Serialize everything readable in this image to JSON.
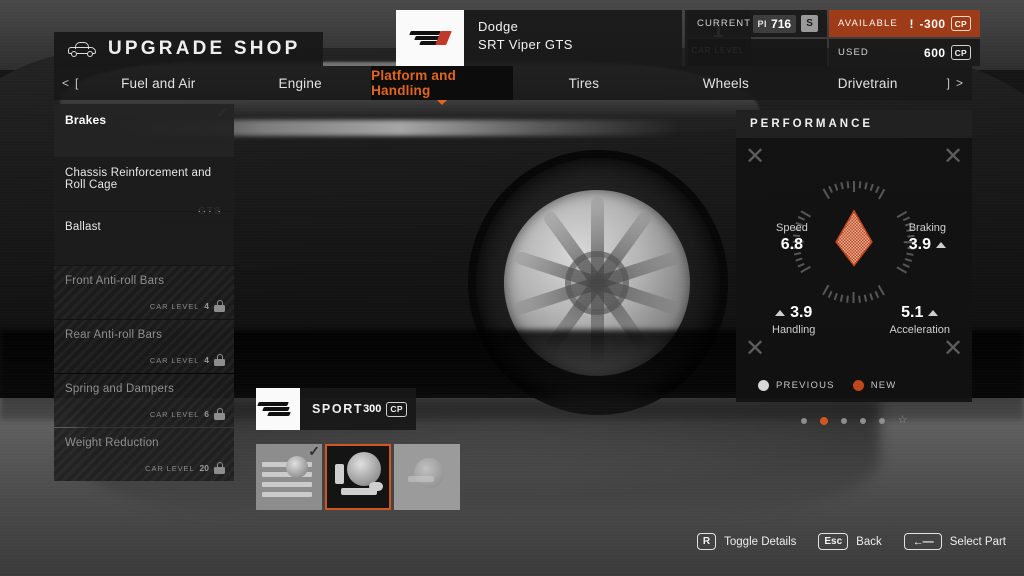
{
  "window": {
    "title": "UPGRADE SHOP",
    "title_icon": "car-icon"
  },
  "car": {
    "make": "Dodge",
    "model": "SRT Viper GTS",
    "level_value": "1",
    "level_label": "CAR LEVEL",
    "logo_icon": "manufacturer-logo"
  },
  "credits": {
    "current_label": "CURRENT",
    "pi_tag": "PI",
    "pi_value": "716",
    "class_letter": "S",
    "available_label": "AVAILABLE",
    "available_value": "-300",
    "available_warning": "!",
    "used_label": "USED",
    "used_value": "600",
    "cp_unit": "CP"
  },
  "tabs": {
    "prev_arrow": "<",
    "prev_bracket": "[",
    "next_bracket": "]",
    "next_arrow": ">",
    "items": [
      {
        "label": "Fuel and Air",
        "active": false
      },
      {
        "label": "Engine",
        "active": false
      },
      {
        "label": "Platform and Handling",
        "active": true
      },
      {
        "label": "Tires",
        "active": false
      },
      {
        "label": "Wheels",
        "active": false
      },
      {
        "label": "Drivetrain",
        "active": false
      }
    ]
  },
  "part_list": {
    "car_level_label": "CAR LEVEL",
    "items": [
      {
        "name": "Brakes",
        "locked": false,
        "selected": true,
        "checked": true,
        "req_level": ""
      },
      {
        "name": "Chassis Reinforcement and Roll Cage",
        "locked": false,
        "selected": false,
        "checked": false,
        "req_level": ""
      },
      {
        "name": "Ballast",
        "locked": false,
        "selected": false,
        "checked": false,
        "req_level": ""
      },
      {
        "name": "Front Anti-roll Bars",
        "locked": true,
        "selected": false,
        "checked": false,
        "req_level": "4"
      },
      {
        "name": "Rear Anti-roll Bars",
        "locked": true,
        "selected": false,
        "checked": false,
        "req_level": "4"
      },
      {
        "name": "Spring and Dampers",
        "locked": true,
        "selected": false,
        "checked": false,
        "req_level": "6"
      },
      {
        "name": "Weight Reduction",
        "locked": true,
        "selected": false,
        "checked": false,
        "req_level": "20"
      }
    ]
  },
  "part_detail": {
    "name": "SPORT",
    "price": "300",
    "price_unit": "CP",
    "logo_icon": "forza-logo"
  },
  "thumbs": [
    {
      "icon": "stock-brakes-thumbnail",
      "selected": false,
      "checked": true,
      "dim": false
    },
    {
      "icon": "sport-brakes-thumbnail",
      "selected": true,
      "checked": false,
      "dim": false
    },
    {
      "icon": "race-brakes-thumbnail",
      "selected": false,
      "checked": false,
      "dim": true
    }
  ],
  "performance": {
    "heading": "PERFORMANCE",
    "legend": [
      {
        "label": "PREVIOUS",
        "color": "#d7d7d7"
      },
      {
        "label": "NEW",
        "color": "#c0471c"
      }
    ]
  },
  "chart_data": {
    "type": "radar",
    "title": "PERFORMANCE",
    "categories": [
      "Speed",
      "Braking",
      "Acceleration",
      "Handling"
    ],
    "axis_positions": [
      "top-left",
      "top-right",
      "bottom-right",
      "bottom-left"
    ],
    "range": [
      0,
      10
    ],
    "series": [
      {
        "name": "NEW",
        "color": "#c0471c",
        "values": [
          6.8,
          3.9,
          5.1,
          3.9
        ]
      }
    ],
    "stat_deltas": [
      {
        "name": "Speed",
        "value": "6.8",
        "arrow": false
      },
      {
        "name": "Braking",
        "value": "3.9",
        "arrow": true
      },
      {
        "name": "Acceleration",
        "value": "5.1",
        "arrow": true
      },
      {
        "name": "Handling",
        "value": "3.9",
        "arrow": true
      }
    ],
    "grid": true,
    "legend_position": "bottom"
  },
  "pager": {
    "dots": [
      {
        "active": false
      },
      {
        "active": true
      },
      {
        "active": false
      },
      {
        "active": false
      },
      {
        "active": false
      }
    ],
    "star": "☆"
  },
  "controls": [
    {
      "key": "R",
      "label": "Toggle Details",
      "wide": false
    },
    {
      "key": "Esc",
      "label": "Back",
      "wide": false
    },
    {
      "key": "←—",
      "label": "Select Part",
      "wide": true
    }
  ]
}
